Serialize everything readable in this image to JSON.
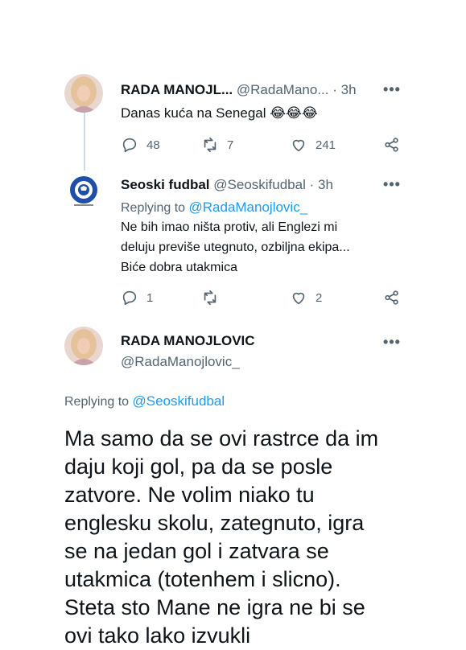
{
  "tweet1": {
    "name": "RADA MANOJL...",
    "handle": "@RadaMano...",
    "separator": "·",
    "time": "3h",
    "text": "Danas kuća na Senegal 😂😂😂",
    "replies": "48",
    "retweets": "7",
    "likes": "241"
  },
  "tweet2": {
    "name": "Seoski fudbal",
    "handle": "@Seoskifudbal",
    "separator": "·",
    "time": "3h",
    "replying_prefix": "Replying to ",
    "replying_handle": "@RadaManojlovic_",
    "text_line1": "Ne bih imao ništa protiv, ali Englezi mi",
    "text_line2": "deluju previše utegnuto, ozbiljna ekipa...",
    "text_line3": "Biće dobra utakmica",
    "replies": "1",
    "retweets": "",
    "likes": "2",
    "logo_text": "SEOSKI FUDBAL"
  },
  "tweet3": {
    "name": "RADA MANOJLOVIC",
    "handle": "@RadaManojlovic_",
    "replying_prefix": "Replying to ",
    "replying_handle": "@Seoskifudbal",
    "lines": [
      "Ma samo da se ovi rastrce da im",
      "daju koji gol, pa da se posle",
      "zatvore. Ne volim niako tu",
      "englesku skolu, zategnuto, igra",
      "se na jedan gol i zatvara se",
      "utakmica (totenhem i slicno).",
      "Steta sto Mane ne igra ne bi se",
      "ovi tako lako izvukli"
    ]
  },
  "more_label": "•••",
  "icons": {
    "reply": "reply-icon",
    "retweet": "retweet-icon",
    "like": "heart-icon",
    "share": "share-icon",
    "more": "more-icon"
  },
  "colors": {
    "link": "#1d9bf0",
    "secondary": "#536471",
    "divider": "#eff3f4"
  }
}
